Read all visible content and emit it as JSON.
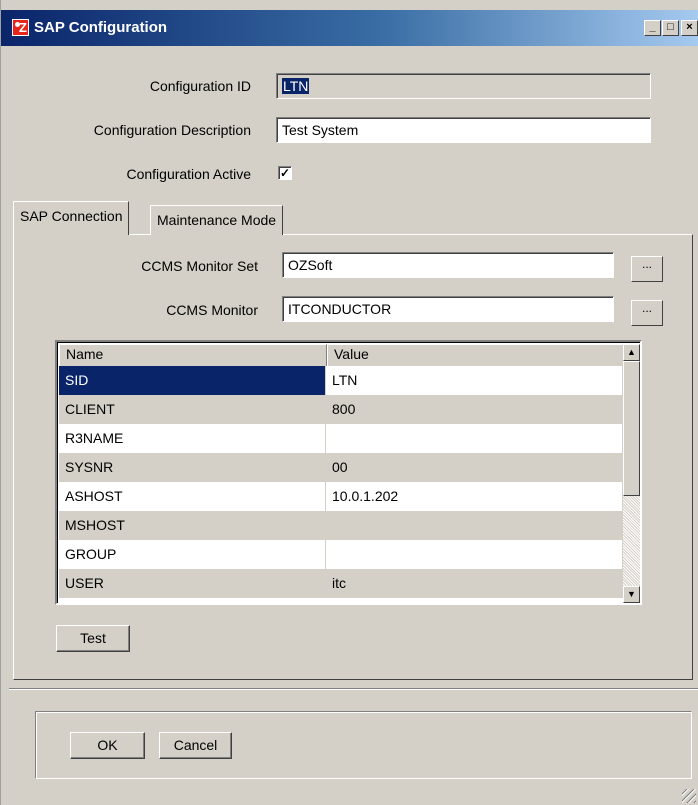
{
  "window": {
    "title": "SAP Configuration",
    "controls": {
      "minimize": "_",
      "maximize": "□",
      "close": "×"
    }
  },
  "form": {
    "config_id_label": "Configuration ID",
    "config_id_value": "LTN",
    "config_desc_label": "Configuration Description",
    "config_desc_value": "Test System",
    "config_active_label": "Configuration Active",
    "config_active_mark": "✓"
  },
  "tabs": [
    {
      "label": "SAP Connection"
    },
    {
      "label": "Maintenance Mode"
    }
  ],
  "connection": {
    "monitor_set_label": "CCMS Monitor Set",
    "monitor_set_value": "OZSoft",
    "monitor_label": "CCMS Monitor",
    "monitor_value": "ITCONDUCTOR",
    "browse_label": "...",
    "grid": {
      "columns": [
        "Name",
        "Value"
      ],
      "rows": [
        {
          "name": "SID",
          "value": "LTN"
        },
        {
          "name": "CLIENT",
          "value": "800"
        },
        {
          "name": "R3NAME",
          "value": ""
        },
        {
          "name": "SYSNR",
          "value": "00"
        },
        {
          "name": "ASHOST",
          "value": "10.0.1.202"
        },
        {
          "name": "MSHOST",
          "value": ""
        },
        {
          "name": "GROUP",
          "value": ""
        },
        {
          "name": "USER",
          "value": "itc"
        }
      ],
      "scroll_up": "▲",
      "scroll_down": "▼"
    },
    "test_label": "Test"
  },
  "footer": {
    "ok_label": "OK",
    "cancel_label": "Cancel"
  },
  "colors": {
    "title_start": "#0a246a",
    "title_end": "#a6caf0",
    "selection": "#0a246a",
    "face": "#d4d0c8"
  }
}
